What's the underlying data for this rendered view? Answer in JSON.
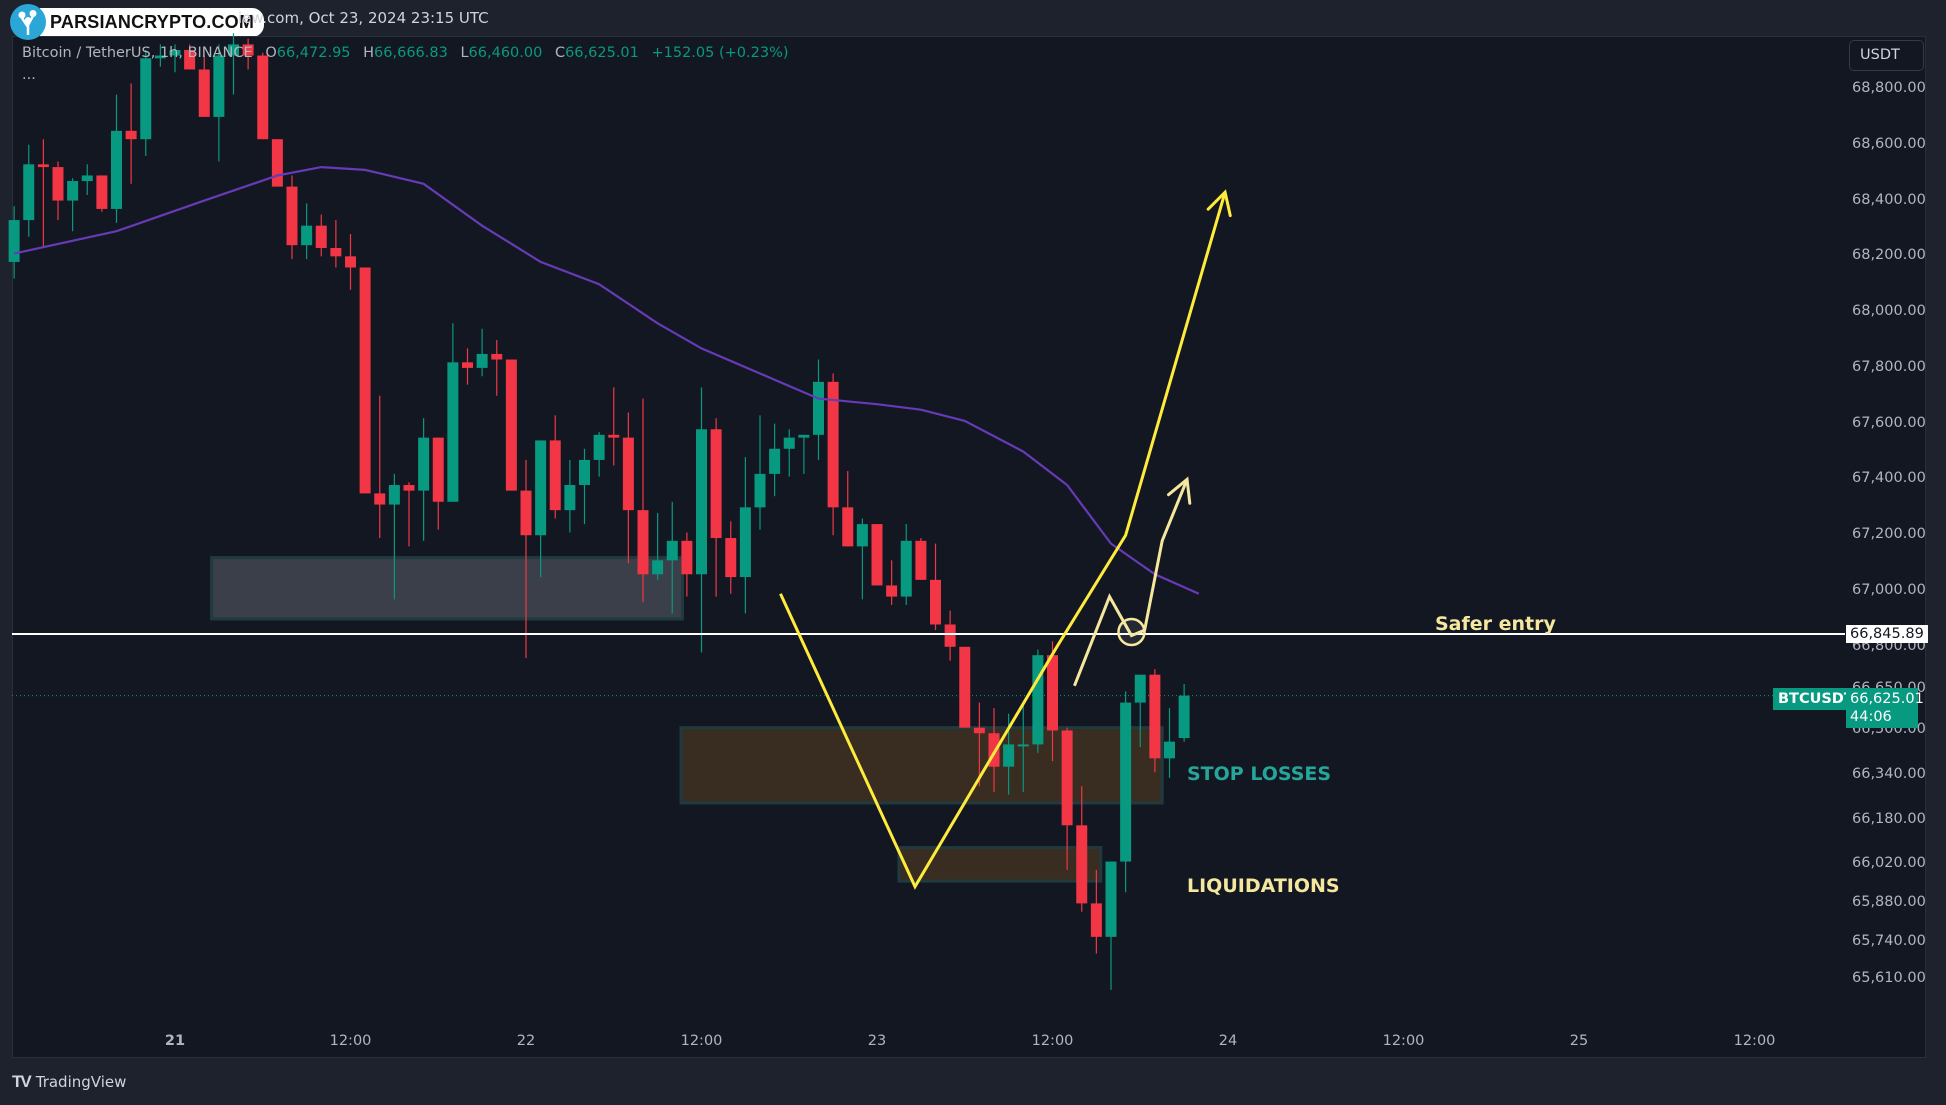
{
  "header": {
    "brand": "PARSIANCRYPTO.COM",
    "snapshot_text": "iew.com, Oct 23, 2024 23:15 UTC"
  },
  "legend": {
    "symbol": "Bitcoin / TetherUS, 1h, BINANCE",
    "open_label": "O",
    "open": "66,472.95",
    "high_label": "H",
    "high": "66,666.83",
    "low_label": "L",
    "low": "66,460.00",
    "close_label": "C",
    "close": "66,625.01",
    "change": "+152.05 (+0.23%)",
    "more": "..."
  },
  "price_axis": {
    "currency_button": "USDT",
    "ticks": [
      "68,800.00",
      "68,600.00",
      "68,400.00",
      "68,200.00",
      "68,000.00",
      "67,800.00",
      "67,600.00",
      "67,400.00",
      "67,200.00",
      "67,000.00",
      "66,800.00",
      "66,650.00",
      "66,500.00",
      "66,340.00",
      "66,180.00",
      "66,020.00",
      "65,880.00",
      "65,740.00",
      "65,610.00"
    ],
    "level_label": "66,845.89",
    "symbol_label": "BTCUSDT",
    "last_price": "66,625.01",
    "countdown": "44:06"
  },
  "time_axis": {
    "ticks": [
      "21",
      "12:00",
      "22",
      "12:00",
      "23",
      "12:00",
      "24",
      "12:00",
      "25",
      "12:00"
    ]
  },
  "annotations": {
    "stop_losses": "STOP LOSSES",
    "liquidations": "LIQUIDATIONS",
    "safer_entry": "Safer entry"
  },
  "footer": {
    "logo": "TV",
    "brand": "TradingView"
  },
  "colors": {
    "up": "#089981",
    "down": "#f23645",
    "ma": "#673ab7",
    "annotation": "#ffeb3b",
    "accent_text": "#26a69a"
  },
  "chart_data": {
    "type": "candlestick",
    "title": "Bitcoin / TetherUS, 1h, BINANCE",
    "ylabel": "USDT",
    "ylim": [
      65540,
      68880
    ],
    "x_start_hour_from_oct21": -11,
    "interval": "1h",
    "key_level": 66845.89,
    "last_price": 66625.01,
    "candles": [
      [
        68180,
        68380,
        68120,
        68330
      ],
      [
        68330,
        68600,
        68270,
        68530
      ],
      [
        68530,
        68620,
        68230,
        68520
      ],
      [
        68520,
        68540,
        68330,
        68400
      ],
      [
        68400,
        68480,
        68290,
        68470
      ],
      [
        68470,
        68530,
        68420,
        68490
      ],
      [
        68490,
        68490,
        68360,
        68370
      ],
      [
        68370,
        68780,
        68320,
        68650
      ],
      [
        68650,
        68820,
        68460,
        68620
      ],
      [
        68620,
        68940,
        68560,
        68910
      ],
      [
        68910,
        68960,
        68880,
        68920
      ],
      [
        68920,
        68960,
        68860,
        68940
      ],
      [
        68940,
        68960,
        68890,
        68870
      ],
      [
        68870,
        68920,
        68700,
        68700
      ],
      [
        68700,
        68960,
        68540,
        68920
      ],
      [
        68920,
        69000,
        68780,
        68960
      ],
      [
        68960,
        68980,
        68870,
        68920
      ],
      [
        68920,
        68930,
        68620,
        68620
      ],
      [
        68620,
        68620,
        68450,
        68450
      ],
      [
        68450,
        68490,
        68190,
        68240
      ],
      [
        68240,
        68390,
        68190,
        68310
      ],
      [
        68310,
        68350,
        68200,
        68230
      ],
      [
        68230,
        68330,
        68160,
        68200
      ],
      [
        68200,
        68280,
        68080,
        68160
      ],
      [
        68160,
        68160,
        67350,
        67350
      ],
      [
        67350,
        67700,
        67190,
        67310
      ],
      [
        67310,
        67420,
        66970,
        67380
      ],
      [
        67380,
        67390,
        67160,
        67360
      ],
      [
        67360,
        67620,
        67180,
        67550
      ],
      [
        67550,
        67550,
        67220,
        67320
      ],
      [
        67320,
        67960,
        67320,
        67820
      ],
      [
        67820,
        67870,
        67740,
        67800
      ],
      [
        67800,
        67940,
        67770,
        67850
      ],
      [
        67850,
        67900,
        67700,
        67830
      ],
      [
        67830,
        67830,
        67360,
        67360
      ],
      [
        67360,
        67470,
        66760,
        67200
      ],
      [
        67200,
        67520,
        67050,
        67540
      ],
      [
        67540,
        67630,
        67260,
        67290
      ],
      [
        67290,
        67470,
        67210,
        67380
      ],
      [
        67380,
        67510,
        67240,
        67470
      ],
      [
        67470,
        67570,
        67410,
        67560
      ],
      [
        67560,
        67730,
        67450,
        67550
      ],
      [
        67550,
        67640,
        67100,
        67290
      ],
      [
        67290,
        67690,
        66960,
        67060
      ],
      [
        67060,
        67280,
        67040,
        67110
      ],
      [
        67110,
        67320,
        66920,
        67180
      ],
      [
        67180,
        67210,
        66980,
        67060
      ],
      [
        67060,
        67730,
        66780,
        67580
      ],
      [
        67580,
        67620,
        66980,
        67190
      ],
      [
        67190,
        67250,
        66990,
        67050
      ],
      [
        67050,
        67480,
        66920,
        67300
      ],
      [
        67300,
        67630,
        67220,
        67420
      ],
      [
        67420,
        67600,
        67340,
        67510
      ],
      [
        67510,
        67580,
        67410,
        67550
      ],
      [
        67550,
        67560,
        67420,
        67560
      ],
      [
        67560,
        67830,
        67470,
        67750
      ],
      [
        67750,
        67780,
        67200,
        67300
      ],
      [
        67300,
        67430,
        67160,
        67160
      ],
      [
        67160,
        67260,
        66970,
        67240
      ],
      [
        67240,
        67240,
        67020,
        67020
      ],
      [
        67020,
        67110,
        66950,
        66980
      ],
      [
        66980,
        67240,
        66950,
        67180
      ],
      [
        67180,
        67190,
        67040,
        67040
      ],
      [
        67040,
        67170,
        66860,
        66880
      ],
      [
        66880,
        66930,
        66750,
        66800
      ],
      [
        66800,
        66800,
        66510,
        66510
      ],
      [
        66510,
        66600,
        66300,
        66490
      ],
      [
        66490,
        66580,
        66280,
        66370
      ],
      [
        66370,
        66560,
        66270,
        66450
      ],
      [
        66450,
        66590,
        66280,
        66450
      ],
      [
        66450,
        66790,
        66420,
        66770
      ],
      [
        66770,
        66820,
        66390,
        66500
      ],
      [
        66500,
        66510,
        66000,
        66160
      ],
      [
        66160,
        66300,
        65850,
        65880
      ],
      [
        65880,
        66000,
        65700,
        65760
      ],
      [
        65760,
        66030,
        65570,
        66030
      ],
      [
        66030,
        66640,
        65920,
        66600
      ],
      [
        66600,
        66680,
        66440,
        66700
      ],
      [
        66700,
        66720,
        66350,
        66400
      ],
      [
        66400,
        66580,
        66330,
        66460
      ],
      [
        66472.95,
        66666.83,
        66460,
        66625.01
      ]
    ],
    "moving_average": {
      "color": "#673ab7",
      "points": [
        [
          -11,
          68210
        ],
        [
          -4,
          68290
        ],
        [
          2,
          68400
        ],
        [
          7,
          68490
        ],
        [
          10,
          68520
        ],
        [
          13,
          68510
        ],
        [
          17,
          68460
        ],
        [
          21,
          68310
        ],
        [
          25,
          68180
        ],
        [
          29,
          68100
        ],
        [
          33,
          67960
        ],
        [
          36,
          67870
        ],
        [
          40,
          67780
        ],
        [
          44,
          67690
        ],
        [
          48,
          67670
        ],
        [
          51,
          67650
        ],
        [
          54,
          67610
        ],
        [
          58,
          67500
        ],
        [
          61,
          67380
        ],
        [
          64,
          67170
        ],
        [
          67,
          67060
        ],
        [
          70,
          66990
        ]
      ]
    },
    "zones": [
      {
        "name": "demand-zone",
        "from_hour": 2.5,
        "to_hour": 34.7,
        "top": 67120,
        "bottom": 66900,
        "color": "#434651"
      },
      {
        "name": "stop-losses-zone",
        "from_hour": 34.6,
        "to_hour": 67.5,
        "top": 66510,
        "bottom": 66240,
        "color": "#3a2e21"
      },
      {
        "name": "liquidations-zone",
        "from_hour": 49.5,
        "to_hour": 63.3,
        "top": 66080,
        "bottom": 65960,
        "color": "#3a2e21"
      }
    ],
    "drawings": [
      {
        "name": "v-path",
        "points": [
          [
            41.4,
            66990
          ],
          [
            50.6,
            65940
          ],
          [
            60.3,
            66800
          ],
          [
            65,
            67200
          ],
          [
            71.8,
            68430
          ]
        ]
      },
      {
        "name": "secondary-path",
        "points": [
          [
            61.5,
            66660
          ],
          [
            63.9,
            66980
          ],
          [
            65.4,
            66840
          ],
          [
            66.3,
            66860
          ],
          [
            67.5,
            67180
          ],
          [
            69.2,
            67400
          ]
        ]
      }
    ]
  }
}
